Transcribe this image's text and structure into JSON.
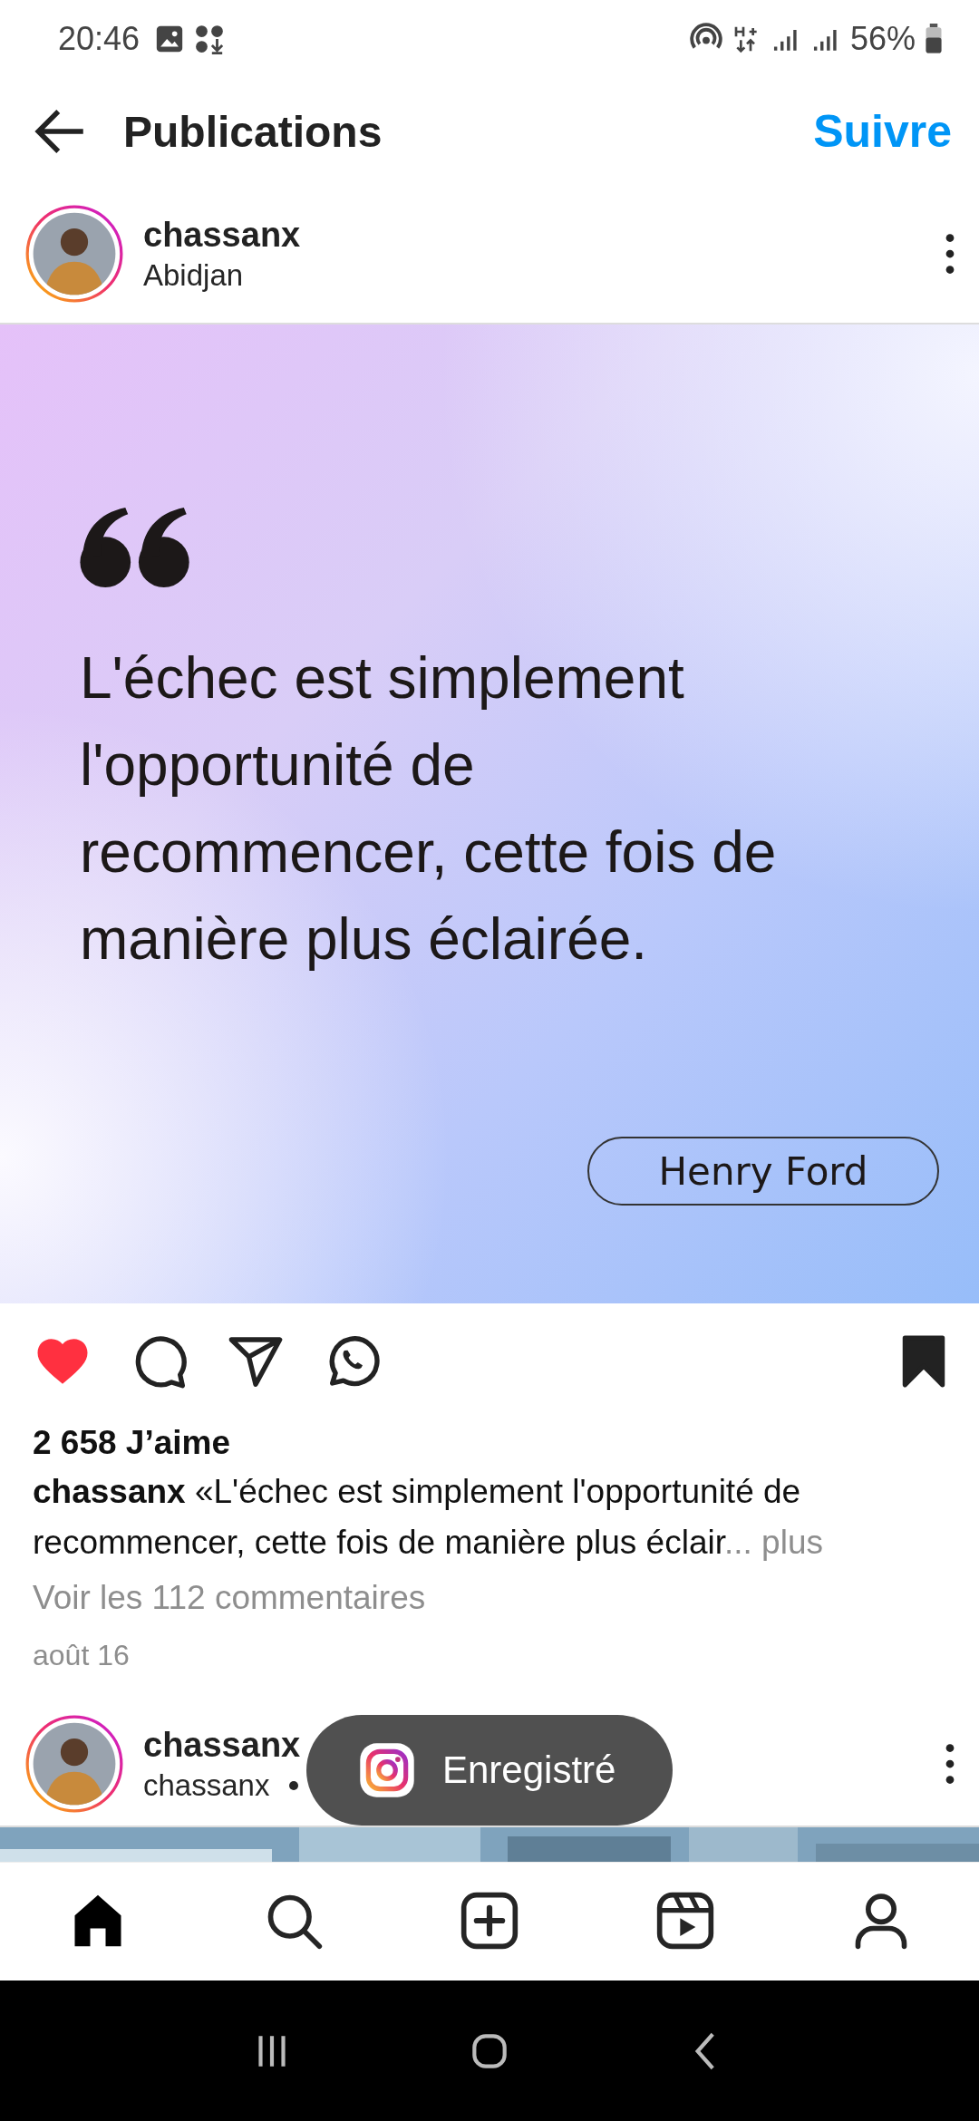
{
  "status_bar": {
    "time": "20:46",
    "battery": "56%"
  },
  "header": {
    "title": "Publications",
    "follow": "Suivre"
  },
  "post": {
    "username": "chassanx",
    "location": "Abidjan",
    "quote_card": {
      "text": "L'échec est simplement l'opportunité de recommencer, cette fois de manière plus éclairée.",
      "author": "Henry Ford"
    },
    "liked": true,
    "saved": true,
    "likes": "2 658 J’aime",
    "caption_user": "chassanx",
    "caption": "«L'échec est simplement l'opportunité de recommencer, cette fois de manière plus éclair",
    "more": "... plus",
    "comments": "Voir les 112 commentaires",
    "date": "août 16"
  },
  "next_post": {
    "username": "chassanx",
    "subtitle": "chassanx"
  },
  "toast": {
    "text": "Enregistré"
  },
  "bottom_nav": [
    {
      "kind": "home",
      "selected": true
    },
    {
      "kind": "search",
      "selected": false
    },
    {
      "kind": "create",
      "selected": false
    },
    {
      "kind": "reels",
      "selected": false
    },
    {
      "kind": "profile",
      "selected": false
    }
  ]
}
